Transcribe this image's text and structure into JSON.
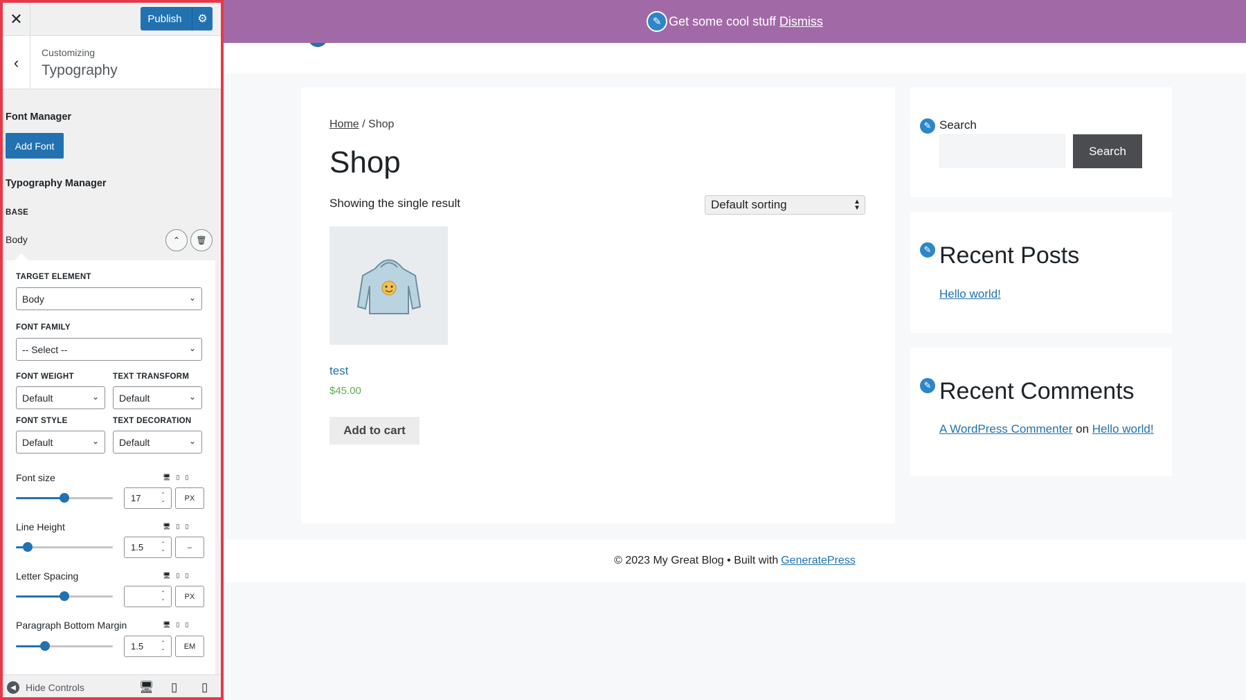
{
  "sidebar": {
    "close_icon": "close-icon",
    "publish_label": "Publish",
    "header_subtitle": "Customizing",
    "header_title": "Typography",
    "font_manager_label": "Font Manager",
    "add_font_label": "Add Font",
    "typography_manager_label": "Typography Manager",
    "base_label": "BASE",
    "body_label": "Body",
    "target_element": {
      "label": "TARGET ELEMENT",
      "value": "Body"
    },
    "font_family": {
      "label": "FONT FAMILY",
      "value": "-- Select --"
    },
    "font_weight": {
      "label": "FONT WEIGHT",
      "value": "Default"
    },
    "text_transform": {
      "label": "TEXT TRANSFORM",
      "value": "Default"
    },
    "font_style": {
      "label": "FONT STYLE",
      "value": "Default"
    },
    "text_decoration": {
      "label": "TEXT DECORATION",
      "value": "Default"
    },
    "controls": [
      {
        "label": "Font size",
        "value": "17",
        "unit": "PX",
        "slider_fraction": 0.5
      },
      {
        "label": "Line Height",
        "value": "1.5",
        "unit": "–",
        "slider_fraction": 0.12
      },
      {
        "label": "Letter Spacing",
        "value": "",
        "unit": "PX",
        "slider_fraction": 0.5
      },
      {
        "label": "Paragraph Bottom Margin",
        "value": "1.5",
        "unit": "EM",
        "slider_fraction": 0.3
      }
    ],
    "hide_controls_label": "Hide Controls"
  },
  "preview": {
    "banner_text": "Get some cool stuff",
    "banner_dismiss": "Dismiss",
    "breadcrumb_home": "Home",
    "breadcrumb_sep": " / Shop",
    "shop_title": "Shop",
    "result_count": "Showing the single result",
    "sorting_value": "Default sorting",
    "product": {
      "name": "test",
      "price": "$45.00",
      "cart_label": "Add to cart"
    },
    "search_widget": {
      "label": "Search",
      "button": "Search"
    },
    "recent_posts": {
      "title": "Recent Posts",
      "link": "Hello world!"
    },
    "recent_comments": {
      "title": "Recent Comments",
      "author": "A WordPress Commenter",
      "on": " on ",
      "post": "Hello world!"
    },
    "footer_text": "© 2023 My Great Blog • Built with",
    "footer_link": "GeneratePress"
  },
  "colors": {
    "accent": "#2271b1",
    "banner": "#a16aa6",
    "highlight_border": "#e7384a",
    "price": "#5eaa4f"
  }
}
